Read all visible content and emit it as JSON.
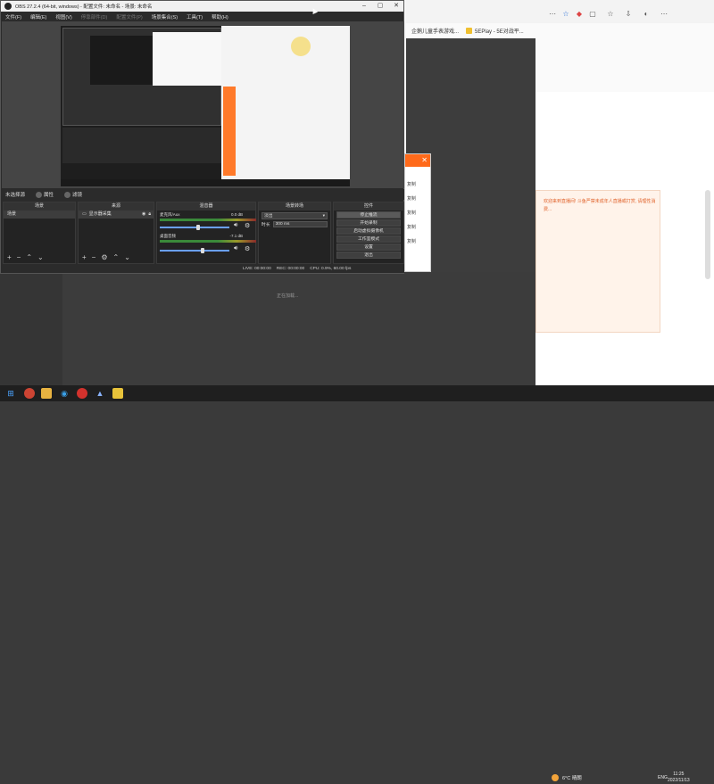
{
  "obs": {
    "title": "OBS 27.2.4 (64-bit, windows) - 配置文件: 未命名 - 场景: 未命名",
    "menu": [
      "文件(F)",
      "编辑(E)",
      "视图(V)",
      "停靠部件(D)",
      "配置文件(P)",
      "场景集合(S)",
      "工具(T)",
      "帮助(H)"
    ],
    "scene_bar": {
      "label": "未选择源",
      "properties": "属性",
      "filters": "滤镜"
    },
    "docks": {
      "scenes": {
        "title": "场景",
        "items": [
          "场景"
        ]
      },
      "sources": {
        "title": "来源",
        "items": [
          "显示器采集"
        ]
      },
      "mixer": {
        "title": "混音器",
        "channels": [
          {
            "name": "麦克风/Aux",
            "db": "0.0 dB",
            "level": 0.55
          },
          {
            "name": "桌面音频",
            "db": "-7.1 dB",
            "level": 0.62
          }
        ]
      },
      "transitions": {
        "title": "场景转场",
        "type": "淡出",
        "duration_label": "时长",
        "duration": "300 ms"
      },
      "controls": {
        "title": "控件",
        "buttons": [
          "停止推流",
          "开始录制",
          "启动虚拟摄像机",
          "工作室模式",
          "设置",
          "退出"
        ]
      }
    },
    "status": {
      "live": "LIVE: 00:00:00",
      "rec": "REC: 00:00:00",
      "cpu": "CPU: 0.9%, 60.00 fps"
    }
  },
  "browser": {
    "bookmarks": [
      {
        "label": "企鹅儿童手表游戏..."
      },
      {
        "label": "5EPlay - 5E对战平..."
      }
    ],
    "loading": "正在加载...",
    "chat": "欢迎来到直播间! 斗鱼严禁未成年人直播或打赏, 请理性消费..."
  },
  "dialog": {
    "options": [
      "复制",
      "复制",
      "复制",
      "复制",
      "复制"
    ]
  },
  "taskbar": {
    "weather": "6°C 晴朗",
    "lang": "ENG",
    "time": "11:25",
    "date": "2022/11/13"
  },
  "colors": {
    "accent": "#ff6a1a",
    "obs_bg": "#2b2b2b"
  }
}
